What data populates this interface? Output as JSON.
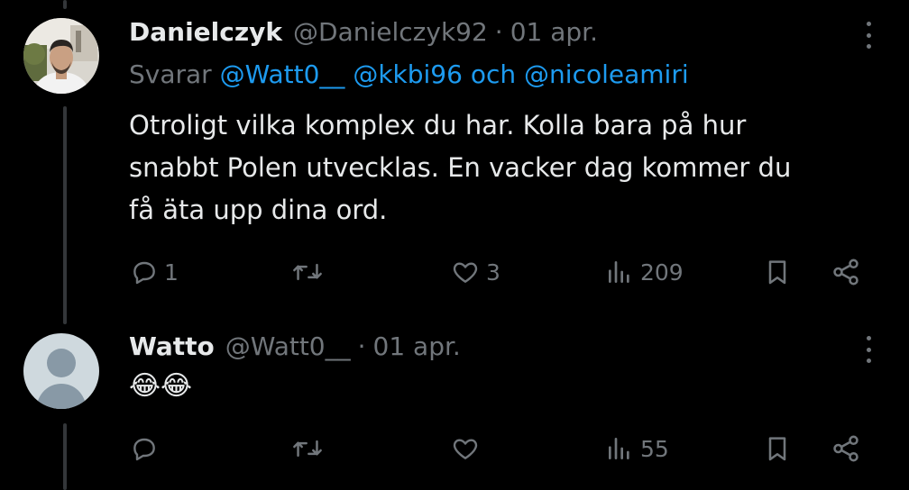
{
  "tweet1": {
    "name": "Danielczyk",
    "handle": "@Danielczyk92",
    "separator": "·",
    "date": "01 apr.",
    "replying_prefix": "Svarar",
    "replying_user1": "@Watt0__",
    "replying_user2": "@kkbi96",
    "replying_conjunction": "och",
    "replying_user3": "@nicoleamiri",
    "text_line1": "Otroligt vilka komplex du har. Kolla bara på hur",
    "text_line2": "snabbt Polen utvecklas. En vacker dag kommer du",
    "text_line3": "få äta upp dina ord.",
    "replies": "1",
    "likes": "3",
    "views": "209"
  },
  "tweet2": {
    "name": "Watto",
    "handle": "@Watt0__",
    "separator": "·",
    "date": "01 apr.",
    "text": "😂😂",
    "views": "55"
  },
  "colors": {
    "background": "#000000",
    "text_primary": "#e7e9ea",
    "text_secondary": "#71767b",
    "link": "#1d9bf0",
    "thread_line": "#333639"
  },
  "icons": [
    "reply-icon",
    "retweet-icon",
    "like-icon",
    "views-icon",
    "bookmark-icon",
    "share-icon",
    "more-icon",
    "default-avatar-icon"
  ]
}
